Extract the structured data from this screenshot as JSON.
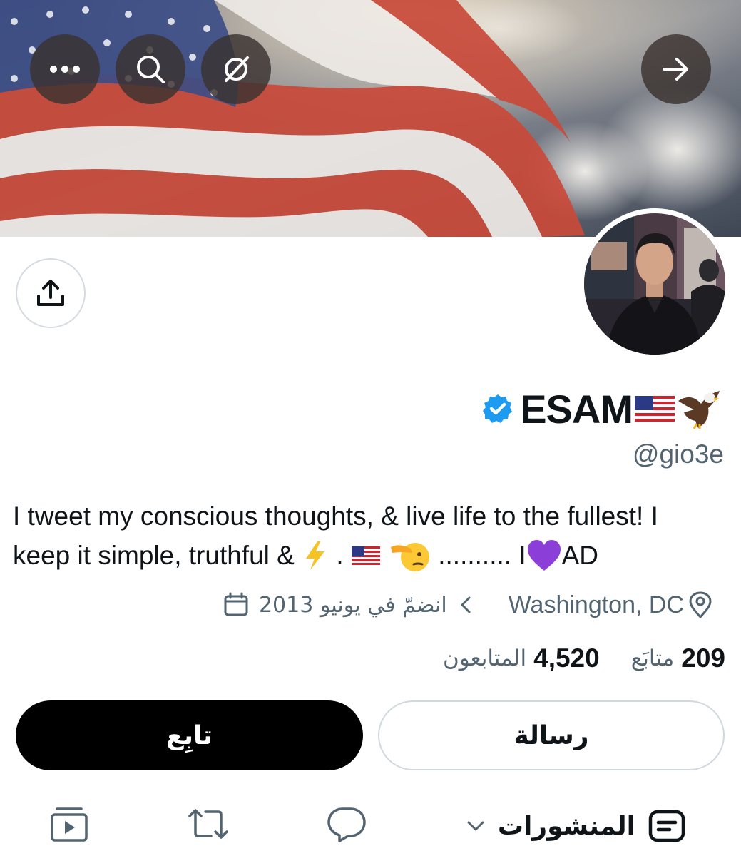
{
  "header": {
    "more_icon": "more-horizontal-icon",
    "search_icon": "search-icon",
    "filter_icon": "slashed-circle-icon",
    "back_icon": "arrow-right-icon"
  },
  "profile": {
    "name": "ESAM",
    "name_emojis": [
      "us-flag",
      "eagle"
    ],
    "verified": true,
    "handle": "@gio3e",
    "bio_line1": "I tweet my conscious thoughts, & live life to the fullest! I",
    "bio_line2_a": "keep it simple, truthful & ",
    "bio_line2_b": " . ",
    "bio_line2_c": " .......... I",
    "bio_line2_d": "AD",
    "location": "Washington, DC",
    "joined": "انضمّ في يونيو 2013",
    "following_count": "209",
    "following_label": "متابَع",
    "followers_count": "4,520",
    "followers_label": "المتابعون"
  },
  "actions": {
    "follow_label": "تابِع",
    "message_label": "رسالة"
  },
  "tabs": {
    "posts_label": "المنشورات"
  },
  "colors": {
    "verified_blue": "#1d9bf0",
    "follow_bg": "#000000",
    "muted_text": "#536471",
    "heart_purple": "#8b3fd8"
  }
}
